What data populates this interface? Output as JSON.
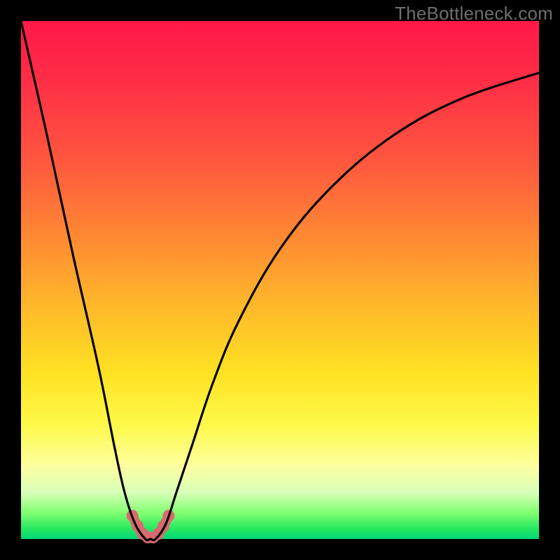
{
  "watermark": "TheBottleneck.com",
  "chart_data": {
    "type": "line",
    "title": "",
    "xlabel": "",
    "ylabel": "",
    "xlim": [
      0,
      100
    ],
    "ylim": [
      0,
      100
    ],
    "grid": false,
    "legend": false,
    "series": [
      {
        "name": "bottleneck-curve",
        "color": "#000000",
        "x": [
          0,
          5,
          10,
          15,
          18,
          20,
          22,
          24,
          25,
          26,
          28,
          30,
          33,
          37,
          42,
          50,
          60,
          72,
          85,
          100
        ],
        "values": [
          100,
          78,
          55,
          33,
          18,
          9,
          3,
          0,
          0,
          0,
          3,
          9,
          18,
          30,
          42,
          56,
          68,
          78,
          85,
          90
        ]
      },
      {
        "name": "bottleneck-marker",
        "color": "#d96a6f",
        "x": [
          21.5,
          22.5,
          23.5,
          24.5,
          25.5,
          26.5,
          27.5,
          28.5
        ],
        "values": [
          4.5,
          2.5,
          1.0,
          0.3,
          0.3,
          1.0,
          2.5,
          4.5
        ]
      }
    ]
  }
}
